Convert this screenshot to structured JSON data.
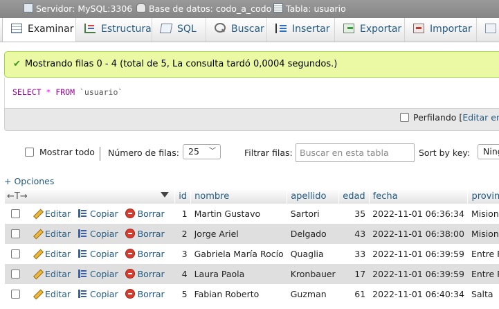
{
  "breadcrumb": {
    "server": "Servidor: MySQL:3306",
    "database": "Base de datos: codo_a_codo",
    "table": "Tabla: usuario",
    "separator": "»"
  },
  "tabs": [
    {
      "label": "Examinar",
      "icon": "browse-icon",
      "active": true
    },
    {
      "label": "Estructura",
      "icon": "structure-icon"
    },
    {
      "label": "SQL",
      "icon": "sql-icon"
    },
    {
      "label": "Buscar",
      "icon": "search-icon"
    },
    {
      "label": "Insertar",
      "icon": "insert-icon"
    },
    {
      "label": "Exportar",
      "icon": "export-icon"
    },
    {
      "label": "Importar",
      "icon": "import-icon"
    }
  ],
  "message": {
    "text": "Mostrando filas 0 - 4 (total de 5, La consulta tardó 0,0004 segundos.)",
    "icon": "check-icon"
  },
  "sql": {
    "keyword_select": "SELECT",
    "star": "*",
    "keyword_from": "FROM",
    "table": "`usuario`"
  },
  "profiling": {
    "label": "Perfilando",
    "edit_prefix": "[",
    "edit_link": "Editar en l"
  },
  "navigation": {
    "show_all": "Mostrar todo",
    "rows_label": "Número de filas:",
    "rows_value": "25",
    "filter_label": "Filtrar filas:",
    "filter_placeholder": "Buscar en esta tabla",
    "sort_label": "Sort by key:",
    "sort_value": "Ning"
  },
  "options_link": "+ Opciones",
  "table": {
    "control_header": "←T→",
    "columns": [
      "id",
      "nombre",
      "apellido",
      "edad",
      "fecha",
      "provincia"
    ],
    "actions": {
      "edit": "Editar",
      "copy": "Copiar",
      "delete": "Borrar"
    },
    "rows": [
      {
        "id": "1",
        "nombre": "Martin Gustavo",
        "apellido": "Sartori",
        "edad": "35",
        "fecha": "2022-11-01 06:36:34",
        "provincia": "Misiones"
      },
      {
        "id": "2",
        "nombre": "Jorge Ariel",
        "apellido": "Delgado",
        "edad": "43",
        "fecha": "2022-11-01 06:38:00",
        "provincia": "Misiones"
      },
      {
        "id": "3",
        "nombre": "Gabriela María Rocío",
        "apellido": "Quaglia",
        "edad": "33",
        "fecha": "2022-11-01 06:39:59",
        "provincia": "Entre Rios"
      },
      {
        "id": "4",
        "nombre": "Laura Paola",
        "apellido": "Kronbauer",
        "edad": "17",
        "fecha": "2022-11-01 06:39:59",
        "provincia": "Entre Rios"
      },
      {
        "id": "5",
        "nombre": "Fabian Roberto",
        "apellido": "Guzman",
        "edad": "61",
        "fecha": "2022-11-01 06:40:34",
        "provincia": "Salta"
      }
    ]
  },
  "colors": {
    "link": "#235a81",
    "success_bg": "#ebf8a4",
    "success_border": "#a2d246",
    "breadcrumb_bg": "#8f8f8f"
  }
}
